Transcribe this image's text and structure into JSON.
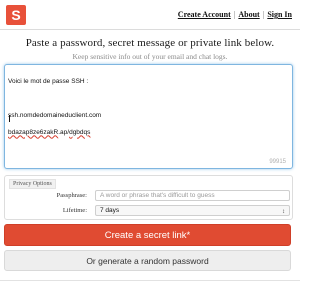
{
  "brand": {
    "logo_letter": "S",
    "color": "#e8513a"
  },
  "topnav": {
    "create_account": "Create Account",
    "about": "About",
    "sign_in": "Sign In",
    "separator": "|"
  },
  "main": {
    "headline": "Paste a password, secret message or private link below.",
    "subheadline": "Keep sensitive info out of your email and chat logs."
  },
  "secret": {
    "line1": "Voici le mot de passe SSH :",
    "line2": "ssh.nomdedomaineduclient.com",
    "line3_part1": "bdazap8ze6zakR",
    "line3_part2": ".ap/",
    "line3_part3": "dgbdqs",
    "char_count": "99915"
  },
  "options": {
    "legend": "Privacy Options",
    "passphrase_label": "Passphrase:",
    "passphrase_placeholder": "A word or phrase that's difficult to guess",
    "lifetime_label": "Lifetime:",
    "lifetime_value": "7 days"
  },
  "buttons": {
    "create": "Create a secret link*",
    "generate": "Or generate a random password"
  }
}
